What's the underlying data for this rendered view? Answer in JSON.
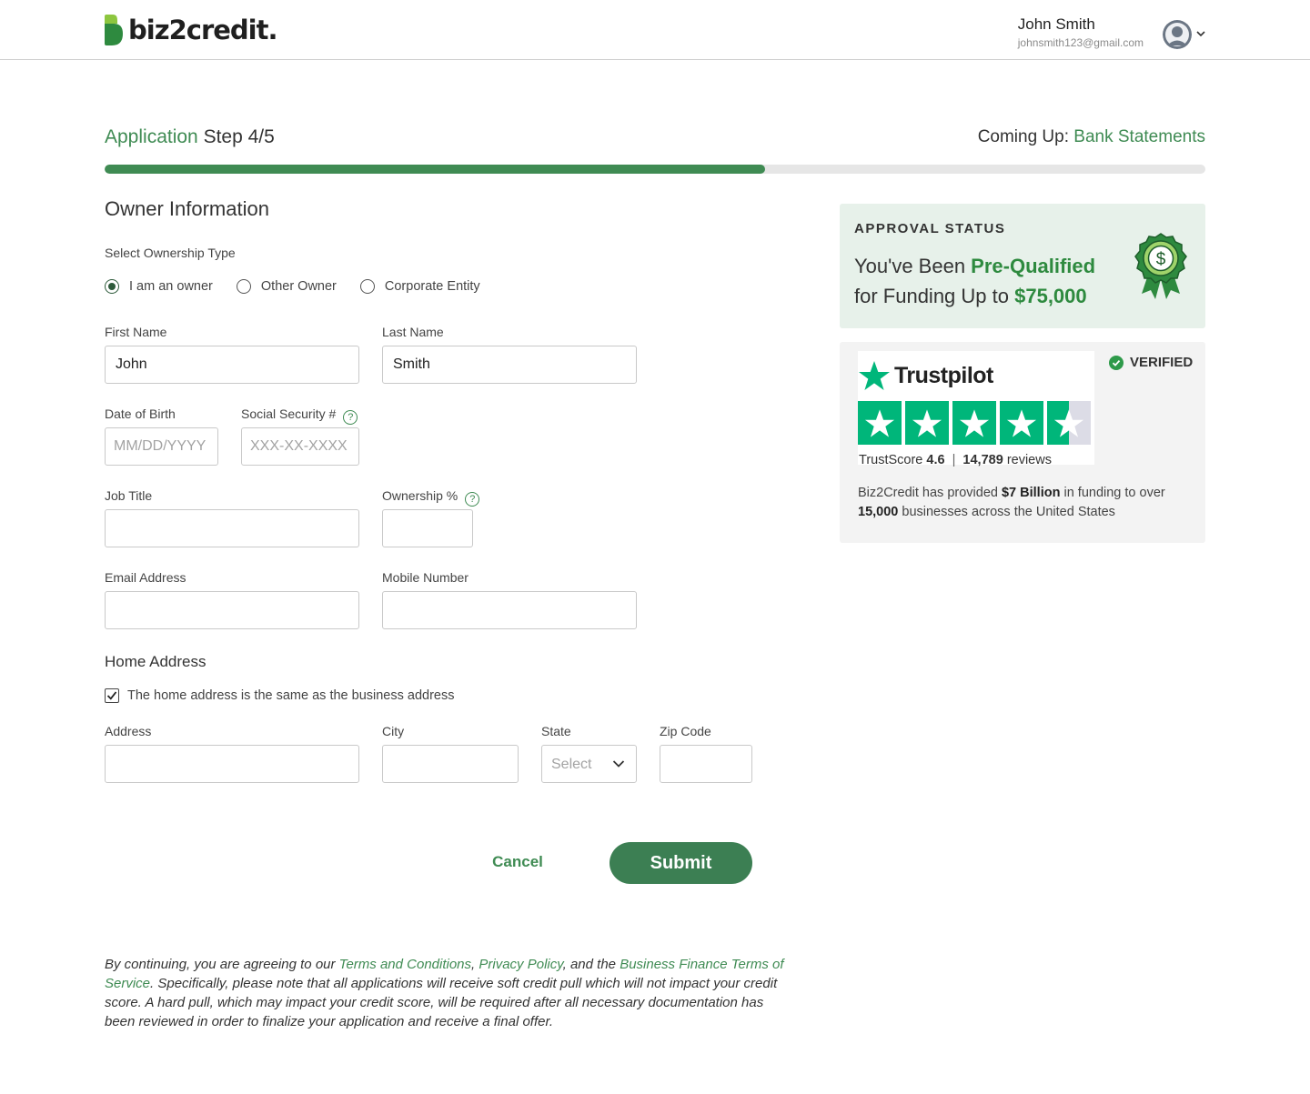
{
  "header": {
    "logo_text": "biz2credit.",
    "user_name": "John Smith",
    "user_email": "johnsmith123@gmail.com"
  },
  "step": {
    "label_accent": "Application",
    "label_rest": "Step 4/5",
    "coming_up_label": "Coming Up:",
    "coming_up_value": "Bank Statements",
    "progress": 0.6
  },
  "form": {
    "section_title": "Owner Information",
    "ownership_label": "Select Ownership Type",
    "ownership_options": [
      "I am an owner",
      "Other Owner",
      "Corporate Entity"
    ],
    "ownership_selected": "I am an owner",
    "first_name_label": "First Name",
    "first_name_value": "John",
    "last_name_label": "Last Name",
    "last_name_value": "Smith",
    "dob_label": "Date of Birth",
    "dob_placeholder": "MM/DD/YYYY",
    "ssn_label": "Social Security #",
    "ssn_placeholder": "XXX-XX-XXXX",
    "job_title_label": "Job Title",
    "ownership_pct_label": "Ownership %",
    "email_label": "Email Address",
    "mobile_label": "Mobile Number",
    "home_address_title": "Home Address",
    "same_address_label": "The home address is the same as the business address",
    "same_address_checked": true,
    "address_label": "Address",
    "city_label": "City",
    "state_label": "State",
    "state_value": "Select",
    "zip_label": "Zip Code",
    "help_glyph": "?"
  },
  "actions": {
    "cancel_label": "Cancel",
    "submit_label": "Submit"
  },
  "legal": {
    "part1": "By continuing, you are agreeing to our ",
    "link1": "Terms and Conditions",
    "sep1": ", ",
    "link2": "Privacy Policy",
    "part2": ", and the ",
    "link3": "Business Finance Terms of Service",
    "part3": ". Specifically, please note that all applications will receive soft credit pull which will not impact your credit score. A hard pull, which may impact your credit score, will be required after all necessary documentation has been reviewed in order to finalize your application and receive a final offer."
  },
  "approval": {
    "kicker": "APPROVAL STATUS",
    "line1_pre": "You've Been ",
    "line1_hl": "Pre-Qualified",
    "line2_pre": "for Funding Up to ",
    "line2_hl": "$75,000",
    "badge_glyph": "$"
  },
  "trustpilot": {
    "brand": "Trustpilot",
    "verified": "VERIFIED",
    "score_label": "TrustScore",
    "score_value": "4.6",
    "divider": "|",
    "reviews_count": "14,789",
    "reviews_label": "reviews",
    "rating": 4.5,
    "desc_1": "Biz2Credit has provided ",
    "desc_b1": "$7 Billion",
    "desc_2": " in funding to over ",
    "desc_b2": "15,000",
    "desc_3": " businesses across the United States"
  },
  "colors": {
    "accent": "#3f8b53",
    "submit_bg": "#3c7f53",
    "trustpilot_green": "#00b67a",
    "approval_bg": "#e7f1ea"
  }
}
